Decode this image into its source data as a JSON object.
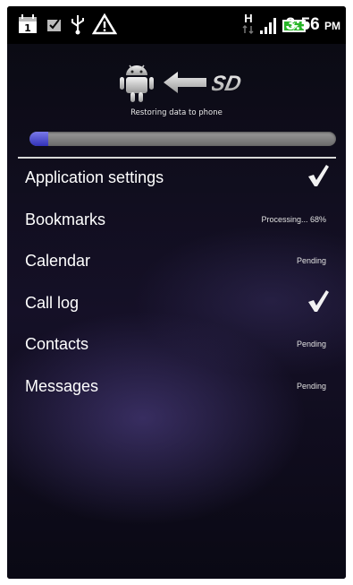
{
  "status_bar": {
    "time": "3:56",
    "ampm": "PM",
    "icons": [
      "calendar-icon",
      "checkbox-notification-icon",
      "usb-icon",
      "warning-icon",
      "h-network-icon",
      "signal-icon",
      "battery-charging-icon"
    ],
    "network_type": "H"
  },
  "restore": {
    "header_icons": [
      "android-robot-icon",
      "arrow-left-icon",
      "sd-card-icon"
    ],
    "sd_logo": "SD",
    "label": "Restoring data to phone",
    "progress": 0.06
  },
  "items": [
    {
      "label": "Application settings",
      "status": "",
      "done": true
    },
    {
      "label": "Bookmarks",
      "status": "Processing... 68%",
      "done": false
    },
    {
      "label": "Calendar",
      "status": "Pending",
      "done": false
    },
    {
      "label": "Call log",
      "status": "",
      "done": true
    },
    {
      "label": "Contacts",
      "status": "Pending",
      "done": false
    },
    {
      "label": "Messages",
      "status": "Pending",
      "done": false
    }
  ]
}
